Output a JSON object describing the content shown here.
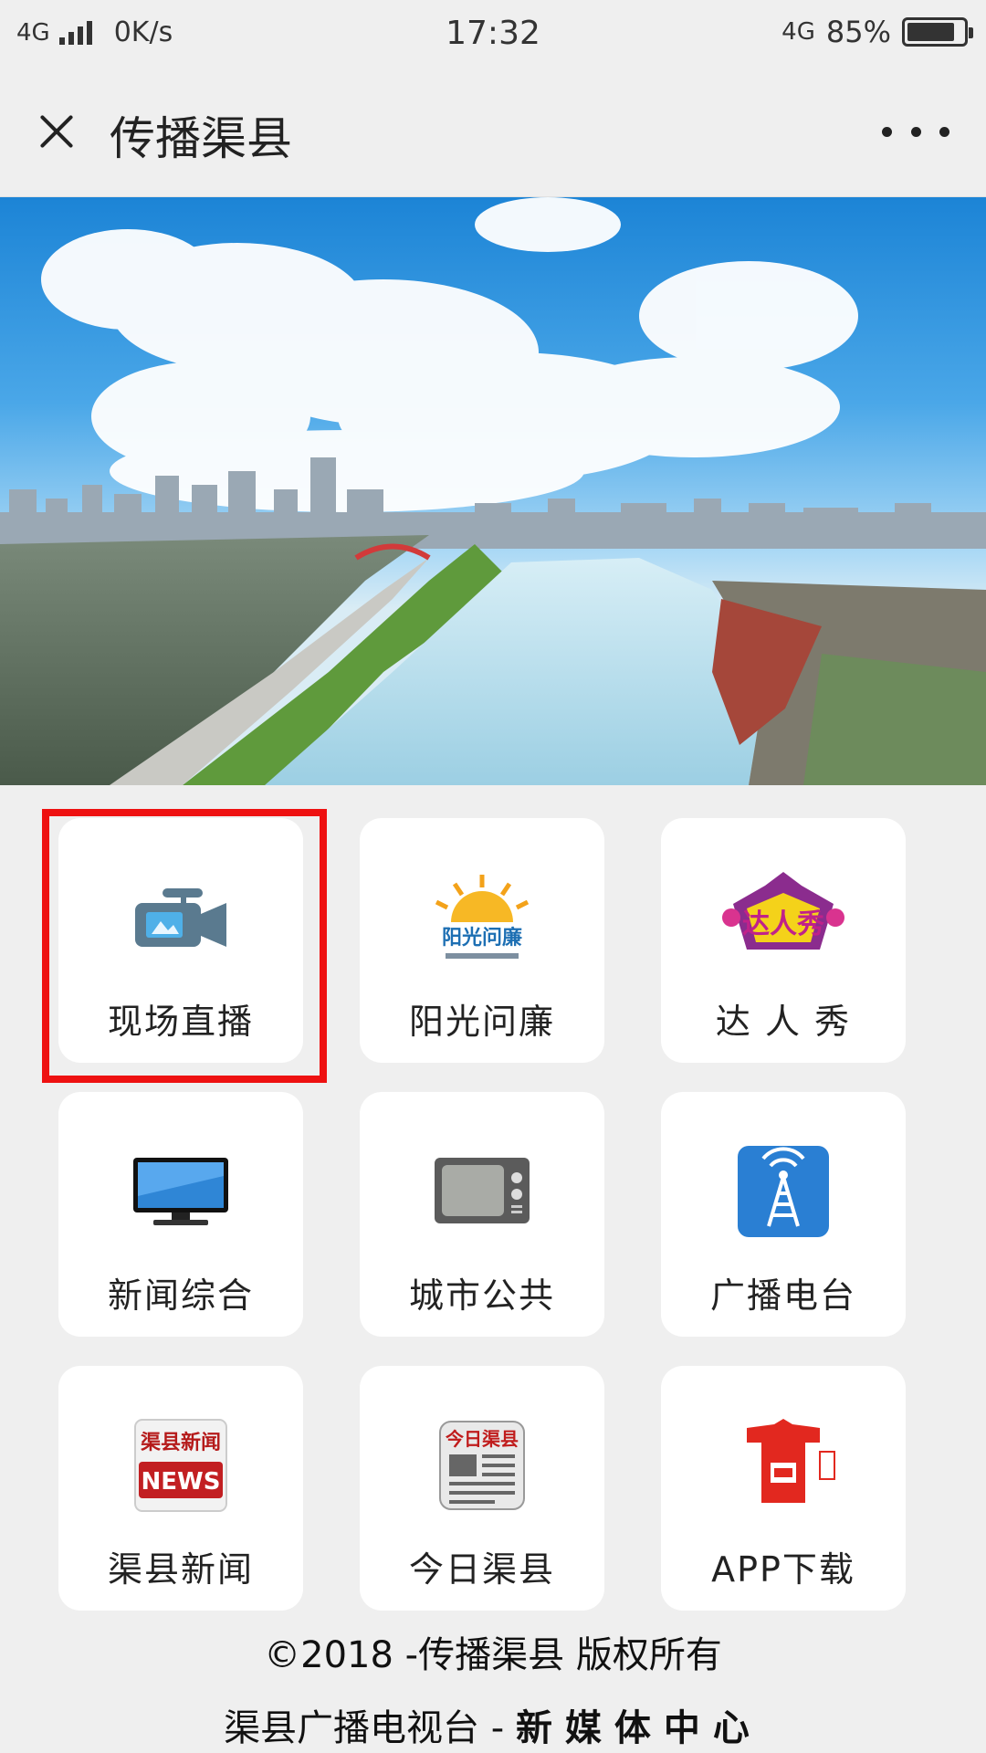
{
  "status_bar": {
    "network_left": "4G",
    "speed": "0K/s",
    "time": "17:32",
    "network_right": "4G",
    "battery_text": "85%",
    "battery_level": 0.85
  },
  "title_bar": {
    "title": "传播渠县",
    "close_icon": "close-icon",
    "more_icon": "more-dots-icon"
  },
  "banner": {
    "image": "city-river-skyline"
  },
  "grid": {
    "items": [
      {
        "label": "现场直播",
        "icon": "video-camera-icon",
        "selected": true
      },
      {
        "label": "阳光问廉",
        "icon": "sunshine-logo-icon",
        "logo_text": "阳光问廉"
      },
      {
        "label": "达 人 秀",
        "icon": "talent-show-logo-icon",
        "logo_text": "达人秀"
      },
      {
        "label": "新闻综合",
        "icon": "lcd-tv-icon"
      },
      {
        "label": "城市公共",
        "icon": "retro-tv-icon"
      },
      {
        "label": "广播电台",
        "icon": "radio-tower-icon"
      },
      {
        "label": "渠县新闻",
        "icon": "news-logo-icon",
        "logo_text": [
          "渠县新闻",
          "NEWS"
        ]
      },
      {
        "label": "今日渠县",
        "icon": "newspaper-icon",
        "logo_text": "今日渠县"
      },
      {
        "label": "APP下载",
        "icon": "app-logo-icon"
      }
    ],
    "highlight_color": "#ee1111"
  },
  "footer": {
    "line1": "©2018 -传播渠县 版权所有",
    "line2_prefix": "渠县广播电视台 - ",
    "line2_bold": "新媒体中心"
  }
}
